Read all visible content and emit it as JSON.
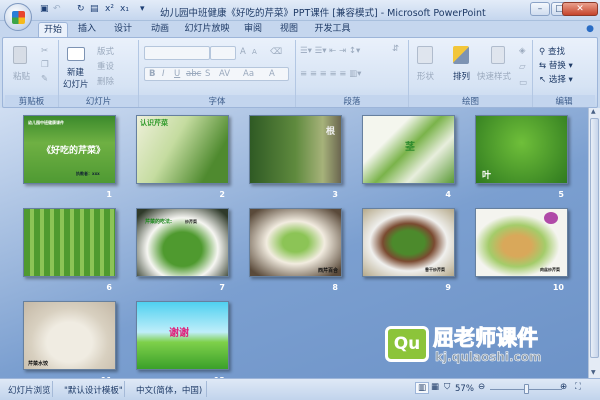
{
  "window": {
    "title": "幼儿园中班健康《好吃的芹菜》PPT课件 [兼容模式] - Microsoft PowerPoint",
    "controls": [
      "minimize",
      "maximize",
      "close"
    ]
  },
  "tabs": [
    "开始",
    "插入",
    "设计",
    "动画",
    "幻灯片放映",
    "审阅",
    "视图",
    "开发工具"
  ],
  "active_tab": "开始",
  "ribbon": {
    "clipboard": {
      "label": "剪贴板",
      "paste": "粘贴"
    },
    "slides": {
      "label": "幻灯片",
      "new_slide_1": "新建",
      "new_slide_2": "幻灯片",
      "layout": "版式",
      "reset": "重设",
      "delete": "删除"
    },
    "font": {
      "label": "字体",
      "buttons": [
        "B",
        "I",
        "U",
        "abc",
        "S",
        "AV",
        "Aa",
        "A"
      ],
      "grow": "A",
      "shrink": "A"
    },
    "paragraph": {
      "label": "段落"
    },
    "drawing": {
      "label": "绘图",
      "shapes": "形状",
      "arrange": "排列",
      "quick_styles": "快速样式"
    },
    "editing": {
      "label": "编辑",
      "find": "查找",
      "replace": "替换",
      "select": "选择"
    }
  },
  "slides": [
    {
      "num": "1",
      "title": "《好吃的芹菜》",
      "subtitle": "幼儿园中班健康课件",
      "caption": "执教者：xxx"
    },
    {
      "num": "2",
      "title": "认识芹菜"
    },
    {
      "num": "3",
      "title": "根"
    },
    {
      "num": "4",
      "title": "茎"
    },
    {
      "num": "5",
      "title": "叶"
    },
    {
      "num": "6",
      "title": ""
    },
    {
      "num": "7",
      "title": "芹菜的吃法:",
      "caption": "炒芹菜"
    },
    {
      "num": "8",
      "title": "",
      "caption": "西芹百合"
    },
    {
      "num": "9",
      "title": "",
      "caption": "香干炒芹菜"
    },
    {
      "num": "10",
      "title": "",
      "caption": "肉丝炒芹菜"
    },
    {
      "num": "11",
      "title": "",
      "caption": "芹菜水饺"
    },
    {
      "num": "12",
      "title": "谢谢"
    }
  ],
  "watermark": {
    "brand": "屈老师课件",
    "url": "kj.qulaoshi.com",
    "logo": "Qu"
  },
  "statusbar": {
    "view": "幻灯片浏览",
    "theme": "\"默认设计模板\"",
    "language": "中文(简体，中国)",
    "zoom": "57%",
    "zoom_percent": 57
  }
}
